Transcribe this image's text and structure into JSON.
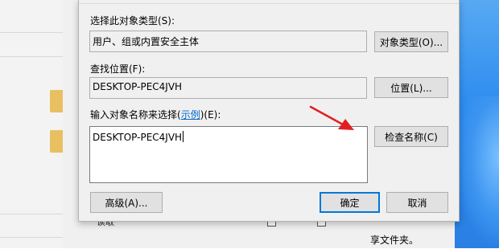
{
  "dialog": {
    "object_type_label": "选择此对象类型(S):",
    "object_type_value": "用户、组或内置安全主体",
    "object_type_button": "对象类型(O)...",
    "location_label": "查找位置(F):",
    "location_value": "DESKTOP-PEC4JVH",
    "location_button": "位置(L)...",
    "names_label_prefix": "输入对象名称来选择(",
    "names_label_link": "示例",
    "names_label_suffix": ")(E):",
    "names_value": "DESKTOP-PEC4JVH",
    "check_names_button": "检查名称(C)",
    "advanced_button": "高级(A)...",
    "ok_button": "确定",
    "cancel_button": "取消"
  },
  "background": {
    "partial_text": "享文件夹。",
    "partial_row_text": "读取"
  },
  "colors": {
    "link": "#0066cc",
    "focus_border": "#0078d7",
    "arrow": "#e02020",
    "folder": "#e8c061"
  },
  "icons": [
    "folder-icon",
    "red-arrow-annotation",
    "checkbox-icon"
  ]
}
